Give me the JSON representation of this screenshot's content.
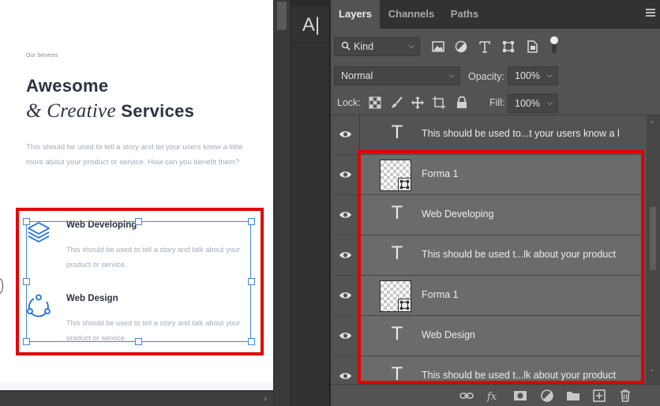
{
  "canvas": {
    "section_label": "Our Services",
    "heading_line1": "Awesome",
    "heading_line2_italic": "& Creative",
    "heading_line2_bold": "Services",
    "intro_text": "This should be used to tell a story and let your users know a little more about your product or service. How can you benefit them?",
    "services": [
      {
        "title": "Web Developing",
        "description": "This should be used to tell a story and talk about your product or service.",
        "icon": "stack-layers-icon"
      },
      {
        "title": "Web Design",
        "description": "This should be used to tell a story and talk about your product or service.",
        "icon": "network-nodes-icon"
      }
    ],
    "colors": {
      "accent": "#1f6fd6",
      "selection": "#3f86d8",
      "highlight": "#e30000",
      "heading": "#2a3340",
      "muted": "#a1abb8"
    }
  },
  "toolstrip": {
    "character_tool_label": "A|"
  },
  "panel": {
    "tabs": [
      {
        "label": "Layers",
        "active": true
      },
      {
        "label": "Channels",
        "active": false
      },
      {
        "label": "Paths",
        "active": false
      }
    ],
    "filter_kind": "Kind",
    "blend_mode": "Normal",
    "opacity_label": "Opacity:",
    "opacity_value": "100%",
    "lock_label": "Lock:",
    "fill_label": "Fill:",
    "fill_value": "100%",
    "layers": [
      {
        "type": "text",
        "name": "This should be used to...t your users know a l",
        "selected": false
      },
      {
        "type": "shape",
        "name": "Forma 1",
        "selected": true
      },
      {
        "type": "text",
        "name": "Web Developing",
        "selected": true
      },
      {
        "type": "text",
        "name": "This should be used t...lk about your product",
        "selected": true
      },
      {
        "type": "shape",
        "name": "Forma 1",
        "selected": true
      },
      {
        "type": "text",
        "name": "Web Design",
        "selected": true
      },
      {
        "type": "text",
        "name": "This should be used t...lk about your product",
        "selected": true
      }
    ]
  }
}
